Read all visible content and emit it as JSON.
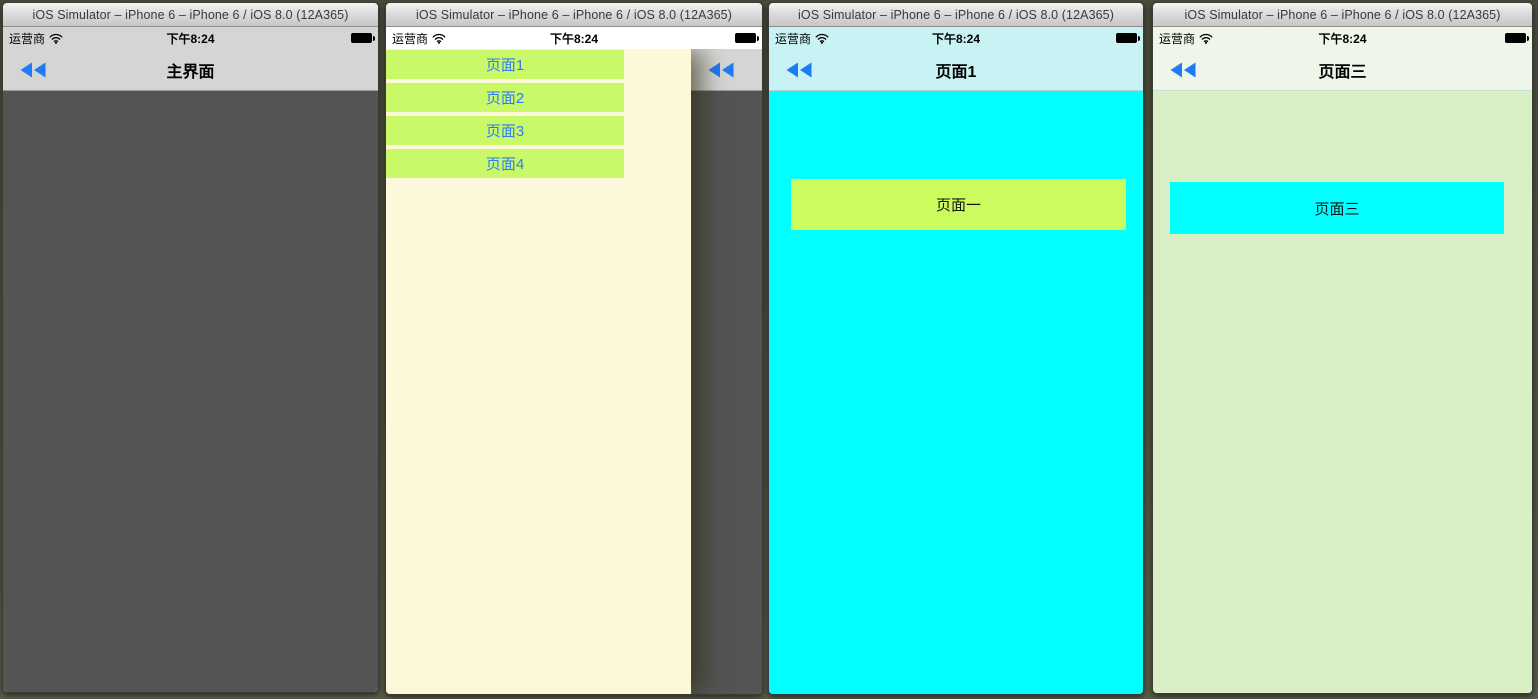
{
  "window_title": "iOS Simulator – iPhone 6 – iPhone 6 / iOS 8.0 (12A365)",
  "status_bar": {
    "carrier": "运营商",
    "time": "下午8:24",
    "wifi_icon": "wifi-icon",
    "battery_icon": "battery-icon"
  },
  "main_window": {
    "nav_title": "主界面"
  },
  "drawer_window": {
    "menu_items": [
      "页面1",
      "页面2",
      "页面3",
      "页面4"
    ]
  },
  "page1_window": {
    "nav_title": "页面1",
    "button_label": "页面一"
  },
  "page3_window": {
    "nav_title": "页面三",
    "button_label": "页面三"
  },
  "colors": {
    "ios_blue": "#1d7bf5",
    "menu_button_green": "#c9f868",
    "menu_text_blue": "#2e7cf5",
    "drawer_cream": "#fcf8d9",
    "chrome_gray": "#d5d5d5",
    "main_body_gray": "#545454",
    "page1_nav_light_cyan": "#c9f2f5",
    "page1_body_cyan": "#00ffff",
    "page1_button_green": "#ccfb5d",
    "page3_nav_pale_green": "#eef6e9",
    "page3_body_light_green": "#d9efc6",
    "page3_button_cyan": "#00ffff",
    "desktop_olive": "#4a4c3b"
  }
}
